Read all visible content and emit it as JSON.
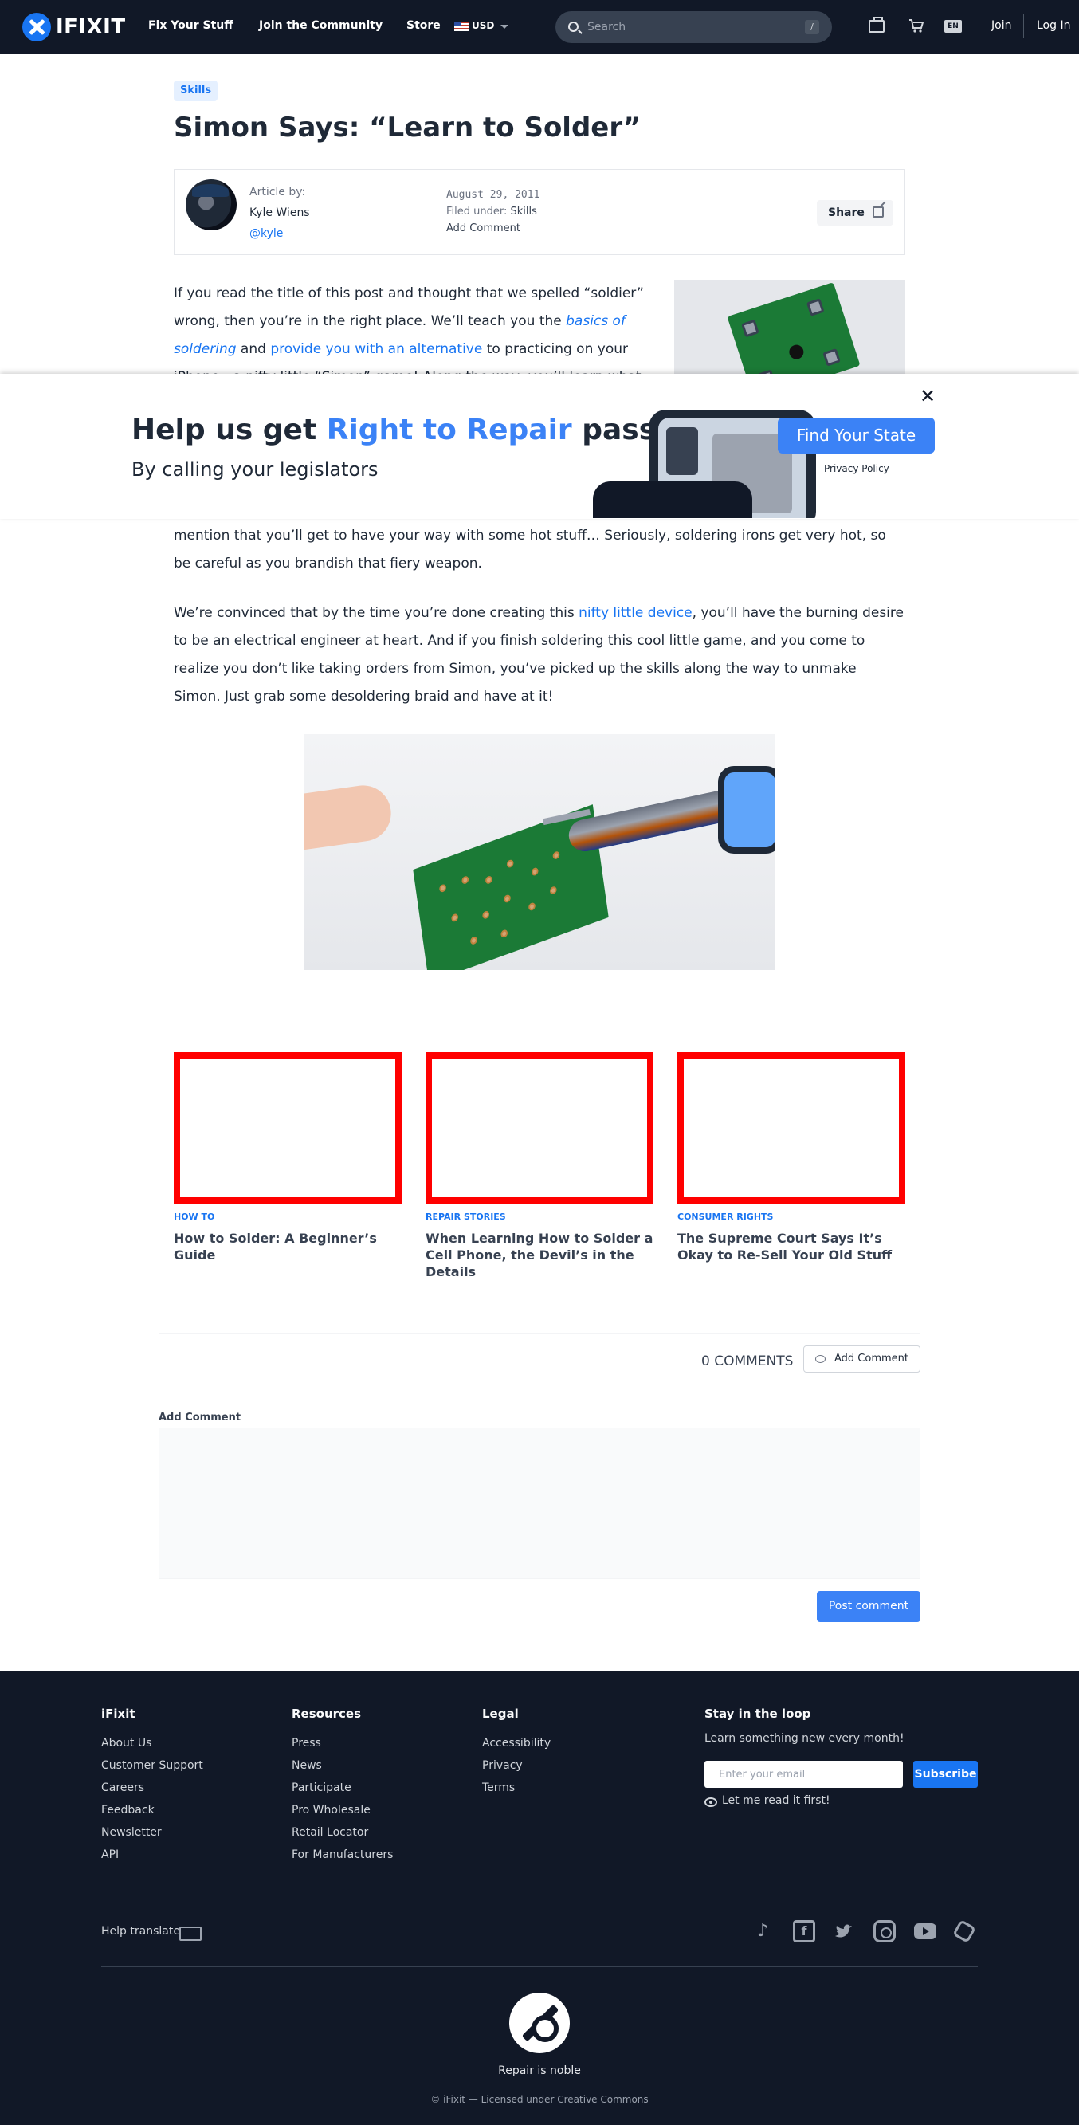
{
  "nav": {
    "logo_text": "IFIXIT",
    "links": [
      "Fix Your Stuff",
      "Join the Community",
      "Store"
    ],
    "currency": "USD",
    "search_placeholder": "Search",
    "search_shortcut": "/",
    "lang": "EN",
    "join": "Join",
    "login": "Log In"
  },
  "article": {
    "tag": "Skills",
    "title": "Simon Says: “Learn to Solder”",
    "meta": {
      "article_by_label": "Article by:",
      "author": "Kyle Wiens",
      "handle": "@kyle",
      "date": "August 29, 2011",
      "filed_under_label": "Filed under:",
      "filed_under": "Skills",
      "add_comment": "Add Comment",
      "share": "Share"
    },
    "p1": {
      "t1": "If you read the title of this post and thought that we spelled “soldier” wrong, then you’re in the right place.  We’ll teach you the ",
      "link1": "basics of soldering",
      "t2": " and ",
      "link2": "provide you with an alternative",
      "t3": " to practicing on your iPhone—a nifty little “Simon” game!  Along the way, you’ll learn what a"
    },
    "p2": "mention that you’ll get to have your way with some hot stuff… Seriously, soldering irons get very hot, so be careful as you brandish that fiery weapon.",
    "p3": {
      "t1": "We’re convinced that by the time you’re done creating this ",
      "link": "nifty little device",
      "t2": ", you’ll have the burning desire to be an electrical engineer at heart. And if you finish soldering this cool little game, and you come to realize you don’t like taking orders from Simon, you’ve picked up the skills along the way to unmake Simon.  Just grab some desoldering braid and have at it!"
    }
  },
  "popup": {
    "close": "✕",
    "headline_pre": "Help us get ",
    "headline_highlight": "Right to Repair",
    "headline_post": " passed",
    "subheadline": "By calling your legislators",
    "cta": "Find Your State",
    "privacy": "Privacy Policy"
  },
  "related": [
    {
      "category": "HOW TO",
      "title": "How to Solder: A Beginner’s Guide"
    },
    {
      "category": "REPAIR STORIES",
      "title": "When Learning How to Solder a Cell Phone, the Devil’s in the Details"
    },
    {
      "category": "CONSUMER RIGHTS",
      "title": "The Supreme Court Says It’s Okay to Re-Sell Your Old Stuff"
    }
  ],
  "comments": {
    "count": "0 COMMENTS",
    "add_button": "Add Comment",
    "form_label": "Add Comment",
    "post_button": "Post comment"
  },
  "footer": {
    "ifixit": {
      "heading": "iFixit",
      "links": [
        "About Us",
        "Customer Support",
        "Careers",
        "Feedback",
        "Newsletter",
        "API"
      ]
    },
    "resources": {
      "heading": "Resources",
      "links": [
        "Press",
        "News",
        "Participate",
        "Pro Wholesale",
        "Retail Locator",
        "For Manufacturers"
      ]
    },
    "legal": {
      "heading": "Legal",
      "links": [
        "Accessibility",
        "Privacy",
        "Terms"
      ]
    },
    "newsletter": {
      "heading": "Stay in the loop",
      "text": "Learn something new every month!",
      "email_placeholder": "Enter your email",
      "subscribe": "Subscribe",
      "read_first": "Let me read it first!"
    },
    "help_translate": "Help translate",
    "social_icons": [
      "tiktok-icon",
      "facebook-icon",
      "twitter-icon",
      "instagram-icon",
      "youtube-icon",
      "hex-icon"
    ],
    "tagline": "Repair is noble",
    "copyright": "© iFixit — Licensed under Creative Commons"
  },
  "colors": {
    "brand": "#1975f2",
    "cta": "#3b82f6",
    "dark": "#111827",
    "related_frame": "#ff0000"
  }
}
